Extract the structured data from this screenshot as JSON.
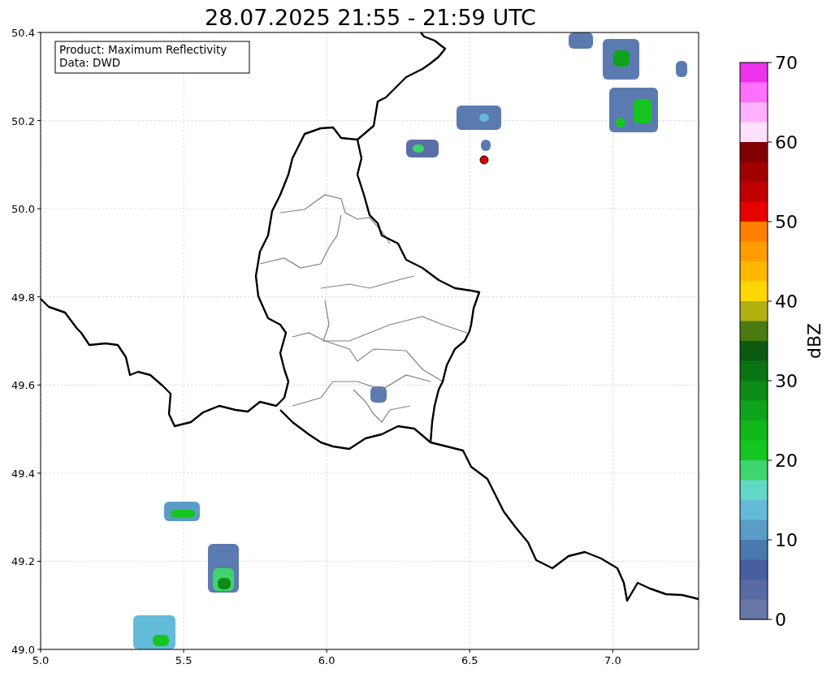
{
  "title": "28.07.2025 21:55 - 21:59 UTC",
  "info_box": {
    "lines": [
      "Product: Maximum Reflectivity",
      "Data: DWD"
    ]
  },
  "map": {
    "x_ticks": [
      "5.0",
      "5.5",
      "6.0",
      "6.5",
      "7.0"
    ],
    "y_ticks": [
      "50.4",
      "50.2",
      "50.0",
      "49.8",
      "49.6",
      "49.4",
      "49.2",
      "49.0"
    ]
  },
  "colorbar": {
    "label": "dBZ",
    "ticks": [
      "70",
      "60",
      "50",
      "40",
      "30",
      "20",
      "10",
      "0"
    ],
    "segments": [
      {
        "color": "#ee33ee"
      },
      {
        "color": "#ff70ff"
      },
      {
        "color": "#ffb0ff"
      },
      {
        "color": "#ffe0ff"
      },
      {
        "color": "#800000"
      },
      {
        "color": "#a00000"
      },
      {
        "color": "#c00000"
      },
      {
        "color": "#e60000"
      },
      {
        "color": "#ff7f00"
      },
      {
        "color": "#ff9c00"
      },
      {
        "color": "#ffb800"
      },
      {
        "color": "#ffd700"
      },
      {
        "color": "#b0b010"
      },
      {
        "color": "#4a7a10"
      },
      {
        "color": "#0a5a10"
      },
      {
        "color": "#0a7312"
      },
      {
        "color": "#0c8b15"
      },
      {
        "color": "#0ea31a"
      },
      {
        "color": "#11b61b"
      },
      {
        "color": "#14c61f"
      },
      {
        "color": "#3fd46e"
      },
      {
        "color": "#63d8c6"
      },
      {
        "color": "#64bbd9"
      },
      {
        "color": "#5b9cc6"
      },
      {
        "color": "#4a78b0"
      },
      {
        "color": "#475ea0"
      },
      {
        "color": "#586aa3"
      },
      {
        "color": "#6677a8"
      }
    ]
  }
}
